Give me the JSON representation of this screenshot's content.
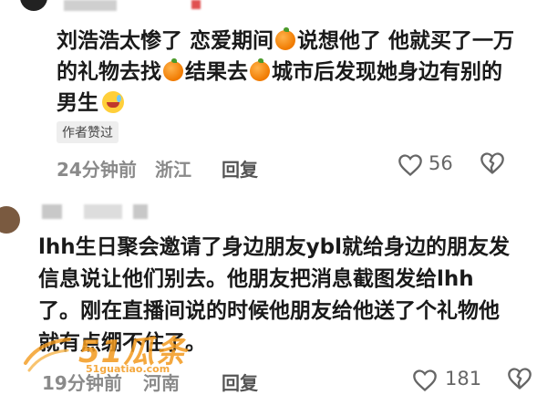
{
  "comment1": {
    "line1": "刘浩浩太惨了 恋爱期间",
    "line1b": "说想他了 他就买了一万",
    "line2a": "的礼物去找",
    "line2b": "结果去",
    "line2c": "城市后发现她身边有别的",
    "line3": "男生",
    "badge": "作者赞过",
    "time": "24分钟前",
    "location": "浙江",
    "reply_label": "回复",
    "like_count": "56"
  },
  "comment2": {
    "line1": "lhh生日聚会邀请了身边朋友ybl就给身边的朋友发",
    "line2": "信息说让他们别去。他朋友把消息截图发给lhh",
    "line3": "了。刚在直播间说的时候他朋友给他送了个礼物他",
    "line4": "就有点绷不住了。",
    "time": "19分钟前",
    "location": "河南",
    "reply_label": "回复",
    "like_count": "181"
  },
  "watermark": {
    "main": "51瓜条",
    "sub": "51guatiao.com"
  },
  "icons": {
    "heart": "heart-icon",
    "dislike": "broken-heart-icon",
    "orange": "tangerine-emoji-icon",
    "laugh": "crying-laughing-emoji-icon"
  },
  "colors": {
    "text": "#1a1a1a",
    "meta": "#8a8a8a",
    "watermark": "#f39a1e"
  }
}
